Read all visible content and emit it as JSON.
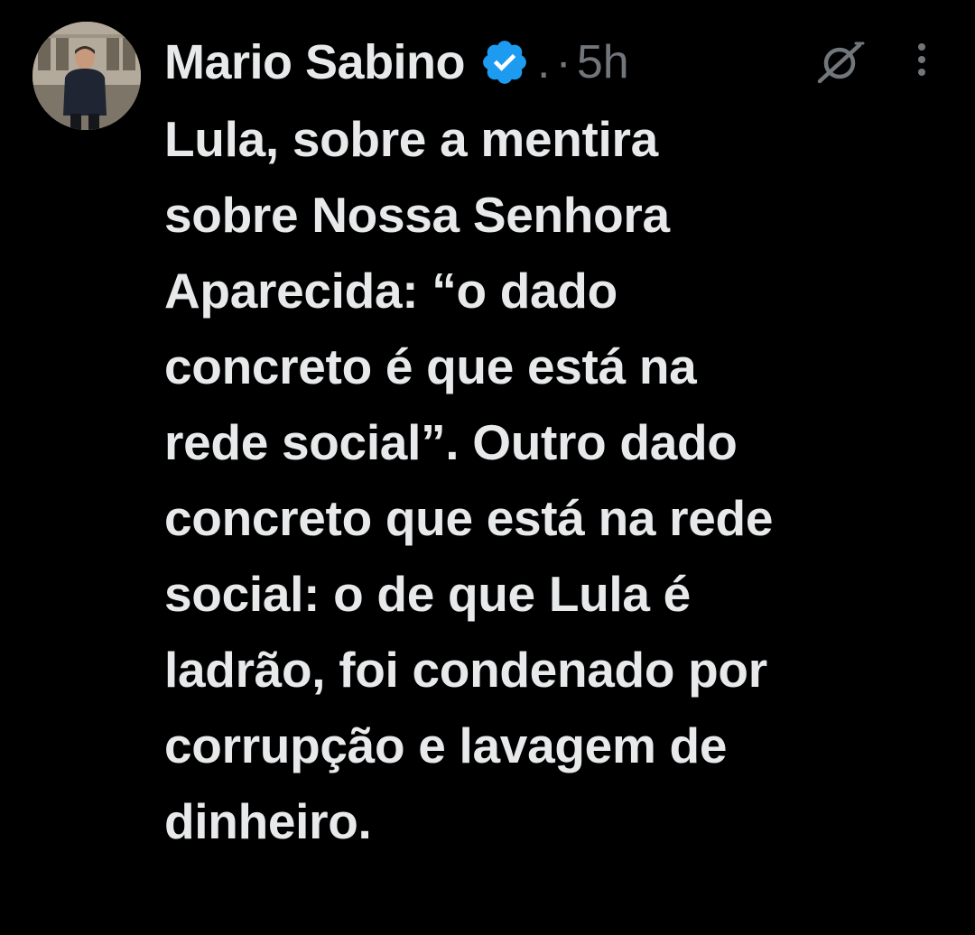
{
  "tweet": {
    "author": {
      "display_name": "Mario Sabino",
      "verified": true,
      "handle": ".",
      "avatar_icon": "user-avatar-photo"
    },
    "separator": "·",
    "time": "5h",
    "grok_icon": "grok-icon",
    "more_icon": "more-vertical-icon",
    "text": "Lula, sobre a mentira\nsobre Nossa Senhora\nAparecida: “o dado\nconcreto é que está na\nrede social”. Outro dado\nconcreto que está na rede\nsocial: o de que Lula é\nladrão, foi condenado por\ncorrupção e lavagem de\ndinheiro."
  },
  "colors": {
    "background": "#000000",
    "text_primary": "#e7e9ea",
    "text_secondary": "#71767b",
    "verified_blue": "#1d9bf0"
  }
}
